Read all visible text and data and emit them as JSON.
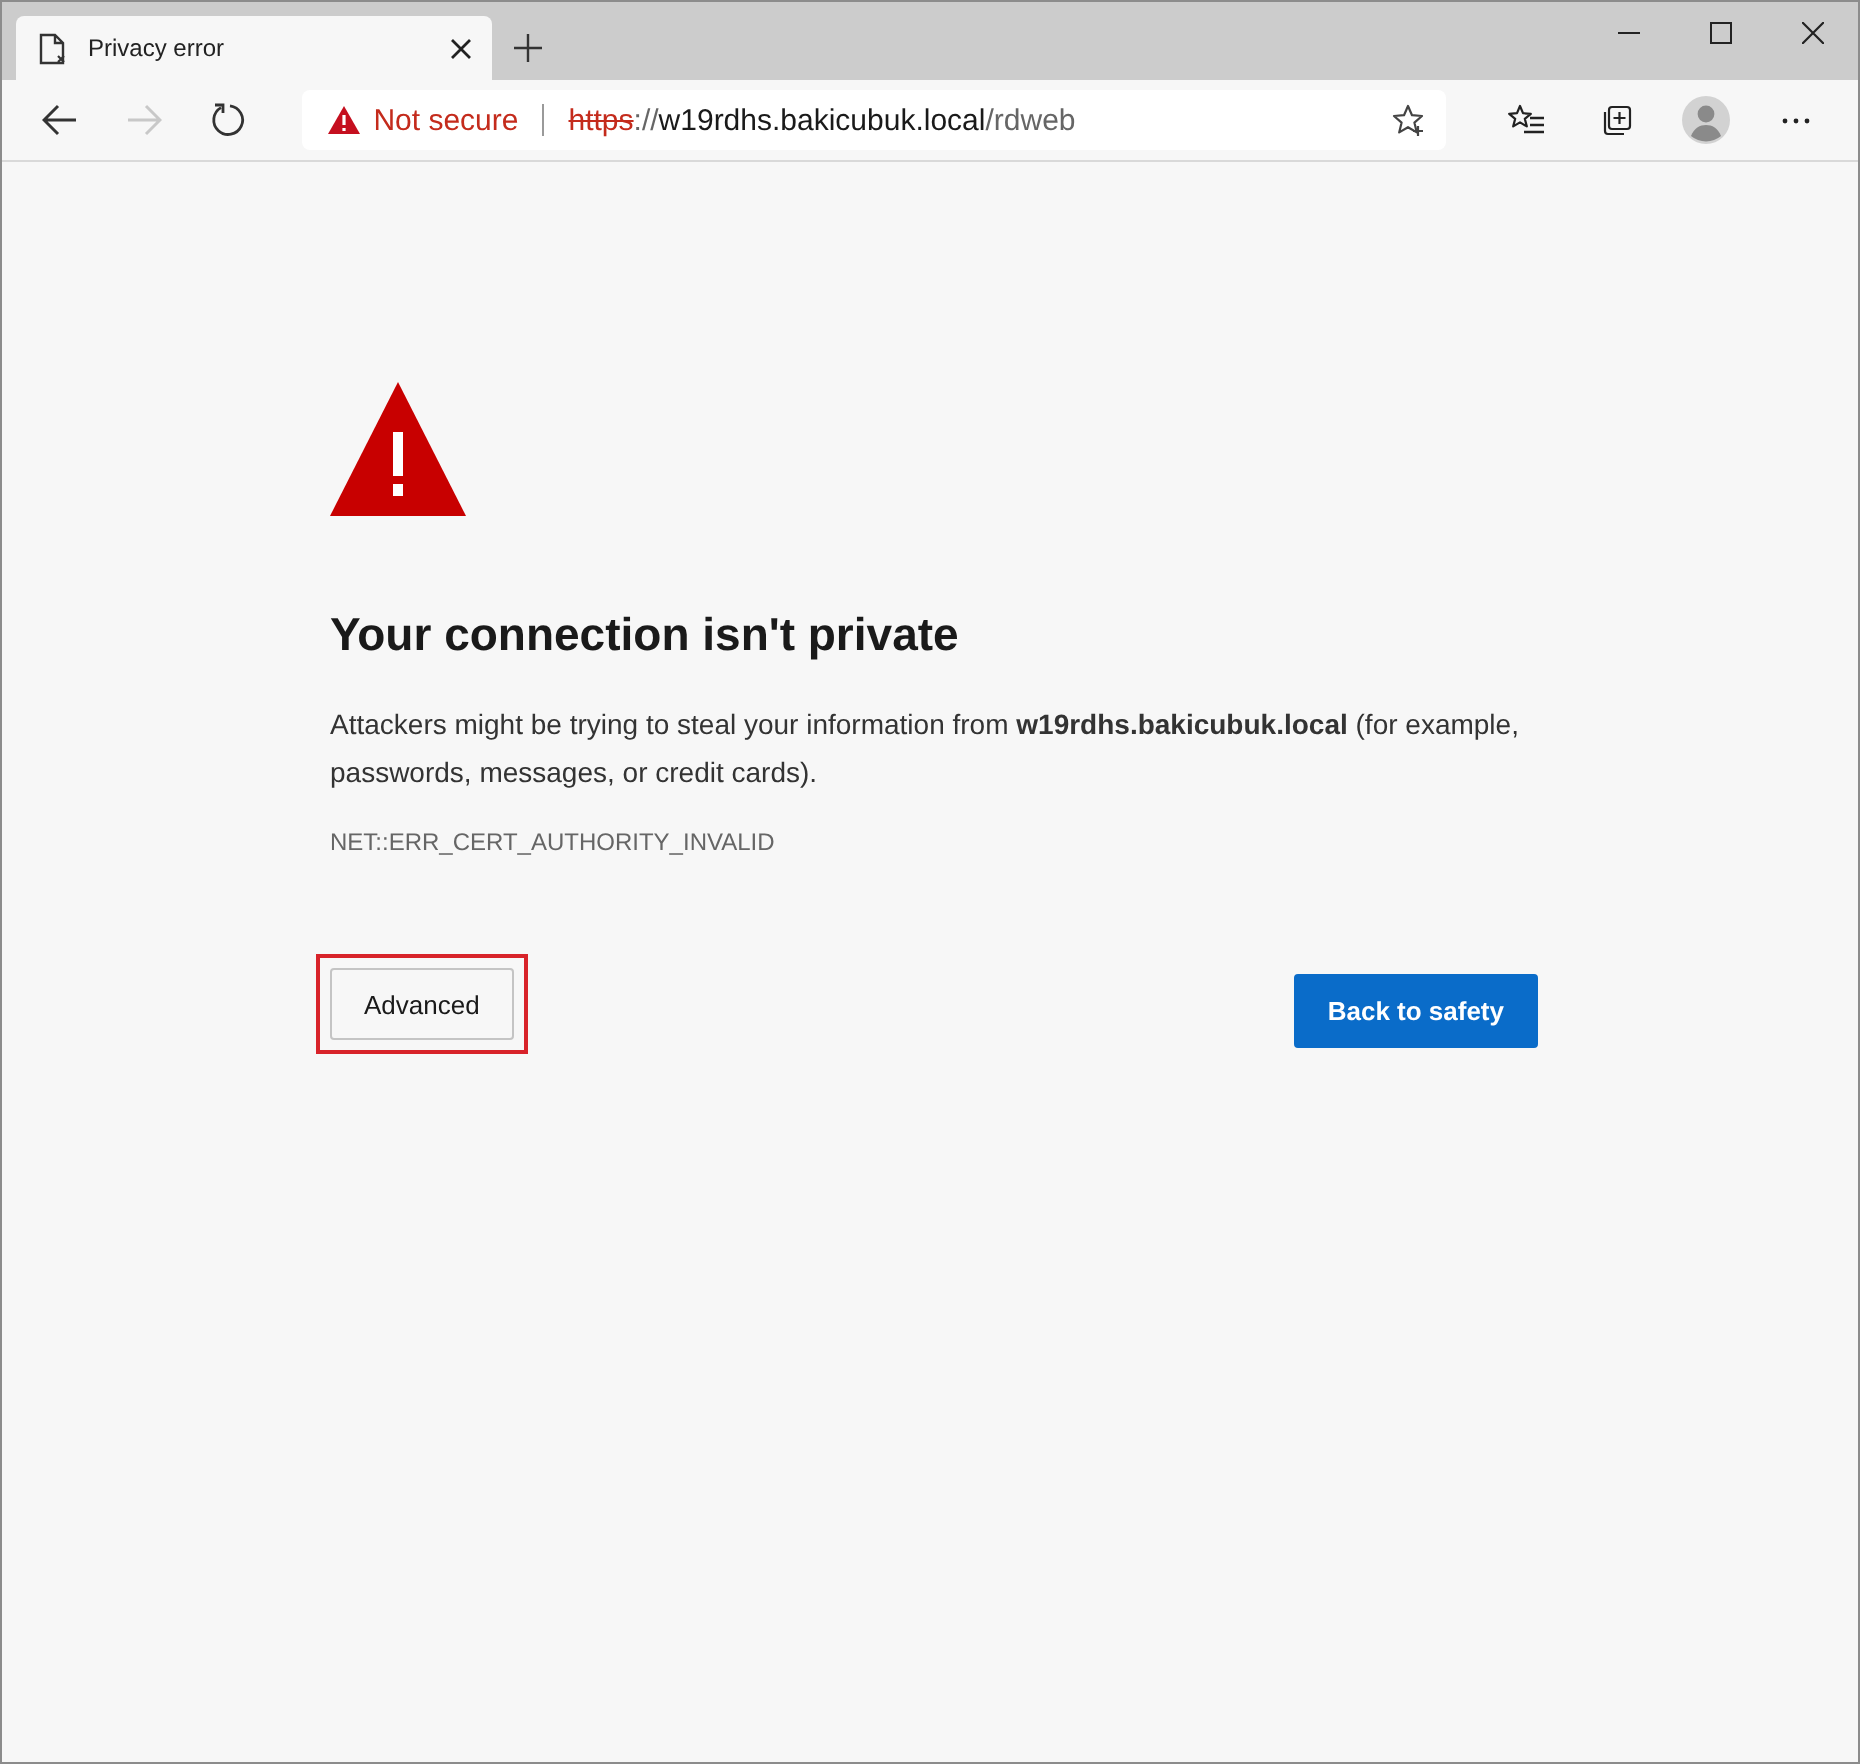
{
  "tabs": [
    {
      "title": "Privacy error",
      "selected": true
    }
  ],
  "navigation": {
    "back_disabled": false,
    "forward_disabled": true
  },
  "address_bar": {
    "security_label": "Not secure",
    "scheme": "https",
    "separator": "://",
    "host": "w19rdhs.bakicubuk.local",
    "path": "/rdweb"
  },
  "page": {
    "heading": "Your connection isn't private",
    "message": "Attackers might be trying to steal your information from **w19rdhs.bakicubuk.local** (for example, passwords, messages, or credit cards).",
    "error_code": "NET::ERR_CERT_AUTHORITY_INVALID"
  },
  "buttons": [
    {
      "label": "Advanced",
      "kind": "secondary",
      "highlighted": true
    },
    {
      "label": "Back to safety",
      "kind": "primary",
      "highlighted": false
    }
  ]
}
